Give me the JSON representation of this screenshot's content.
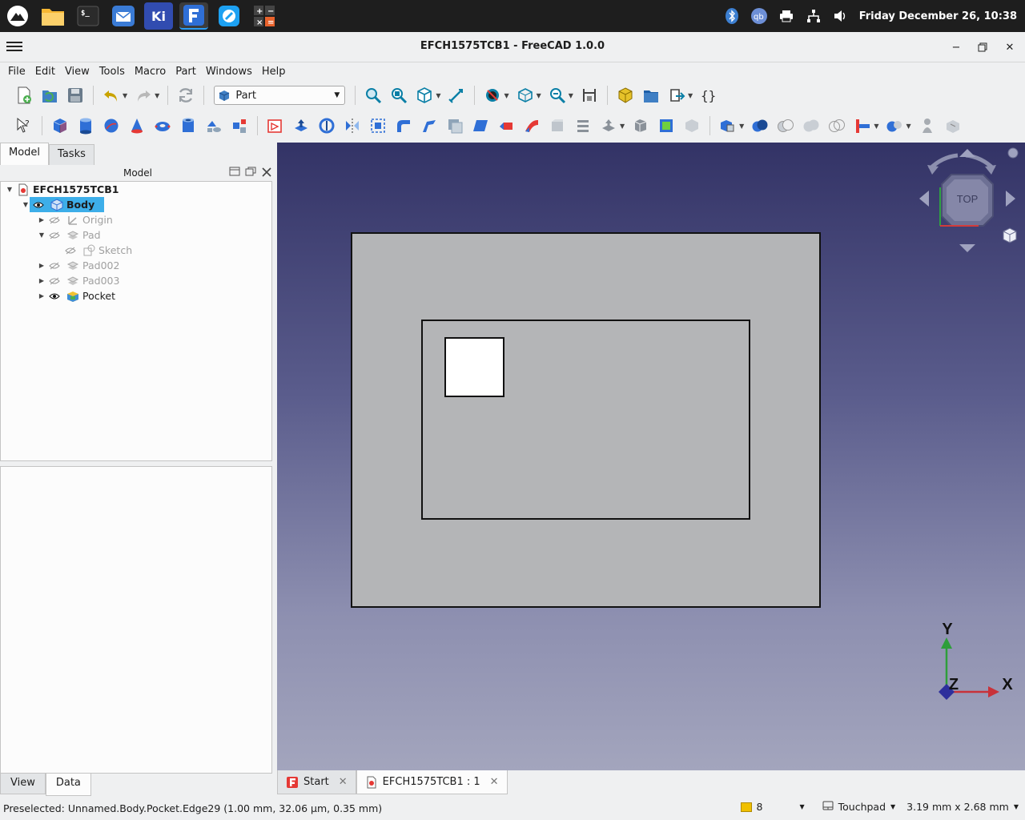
{
  "window": {
    "title": "EFCH1575TCB1 - FreeCAD 1.0.0"
  },
  "taskbar": {
    "clock": "Friday December 26, 10:38",
    "apps": [
      "launcher-icon",
      "file-manager-icon",
      "terminal-icon",
      "mail-icon",
      "kicad-icon",
      "freecad-icon",
      "browser-icon",
      "calculator-icon"
    ]
  },
  "menu": {
    "items": [
      "File",
      "Edit",
      "View",
      "Tools",
      "Macro",
      "Part",
      "Windows",
      "Help"
    ]
  },
  "toolbar": {
    "workbench": "Part"
  },
  "panel": {
    "tabs": [
      "Model",
      "Tasks"
    ],
    "header": "Model",
    "bottom_tabs": [
      "View",
      "Data"
    ]
  },
  "tree": {
    "root": "EFCH1575TCB1",
    "items": [
      {
        "label": "Body"
      },
      {
        "label": "Origin"
      },
      {
        "label": "Pad"
      },
      {
        "label": "Sketch"
      },
      {
        "label": "Pad002"
      },
      {
        "label": "Pad003"
      },
      {
        "label": "Pocket"
      }
    ]
  },
  "view": {
    "navcube_face": "TOP",
    "axis_labels": {
      "x": "X",
      "y": "Y",
      "z": "Z"
    },
    "colors": {
      "bg_top": "#333366",
      "bg_bottom": "#a3a5bd",
      "solid": "#b4b5b7",
      "hole": "#ffffff"
    }
  },
  "doctabs": [
    "Start",
    "EFCH1575TCB1 : 1"
  ],
  "status": {
    "message": "Preselected: Unnamed.Body.Pocket.Edge29 (1.00 mm, 32.06 µm, 0.35 mm)",
    "count": "8",
    "nav_style": "Touchpad",
    "dimensions": "3.19 mm x 2.68 mm"
  }
}
